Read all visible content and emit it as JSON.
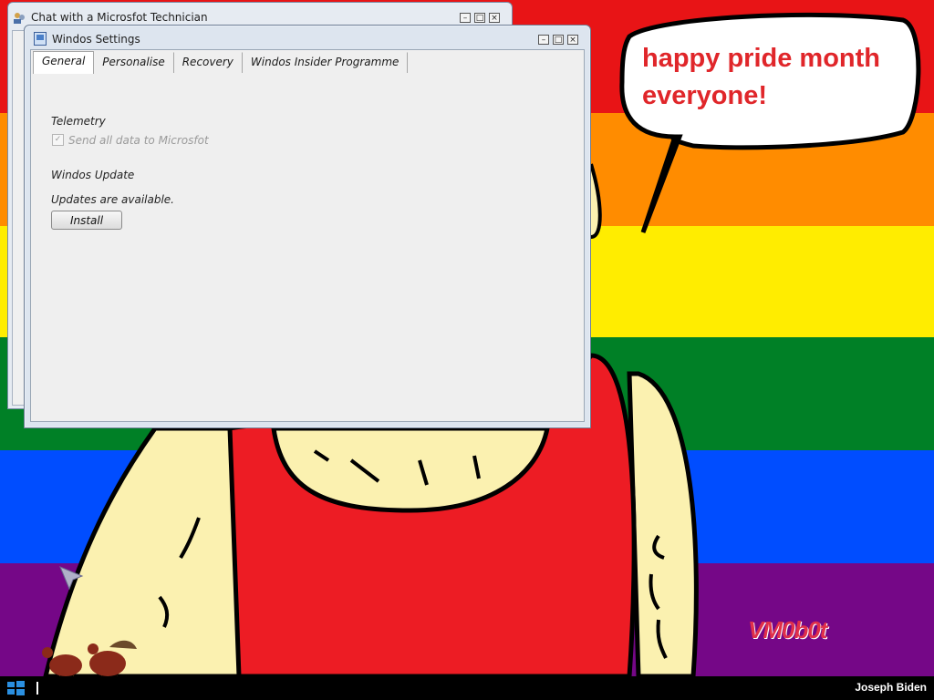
{
  "desktop": {
    "rainbow_colors": [
      "#e81416",
      "#ff8c00",
      "#ffed00",
      "#008026",
      "#004dff",
      "#750787"
    ],
    "speech_bubble_text": "happy pride month everyone!",
    "watermark": "VM0b0t"
  },
  "back_window": {
    "title": "Chat with a Microsfot Technician",
    "controls": [
      "minimize",
      "maximize",
      "close"
    ]
  },
  "settings_window": {
    "title": "Windos Settings",
    "tabs": [
      {
        "label": "General",
        "active": true
      },
      {
        "label": "Personalise",
        "active": false
      },
      {
        "label": "Recovery",
        "active": false
      },
      {
        "label": "Windos Insider Programme",
        "active": false
      }
    ],
    "telemetry": {
      "heading": "Telemetry",
      "checkbox_label": "Send all data to Microsfot",
      "checked": true,
      "disabled": true
    },
    "update": {
      "heading": "Windos Update",
      "status": "Updates are available.",
      "button": "Install"
    }
  },
  "taskbar": {
    "start_icon": "windows-logo-icon",
    "user": "Joseph Biden"
  }
}
